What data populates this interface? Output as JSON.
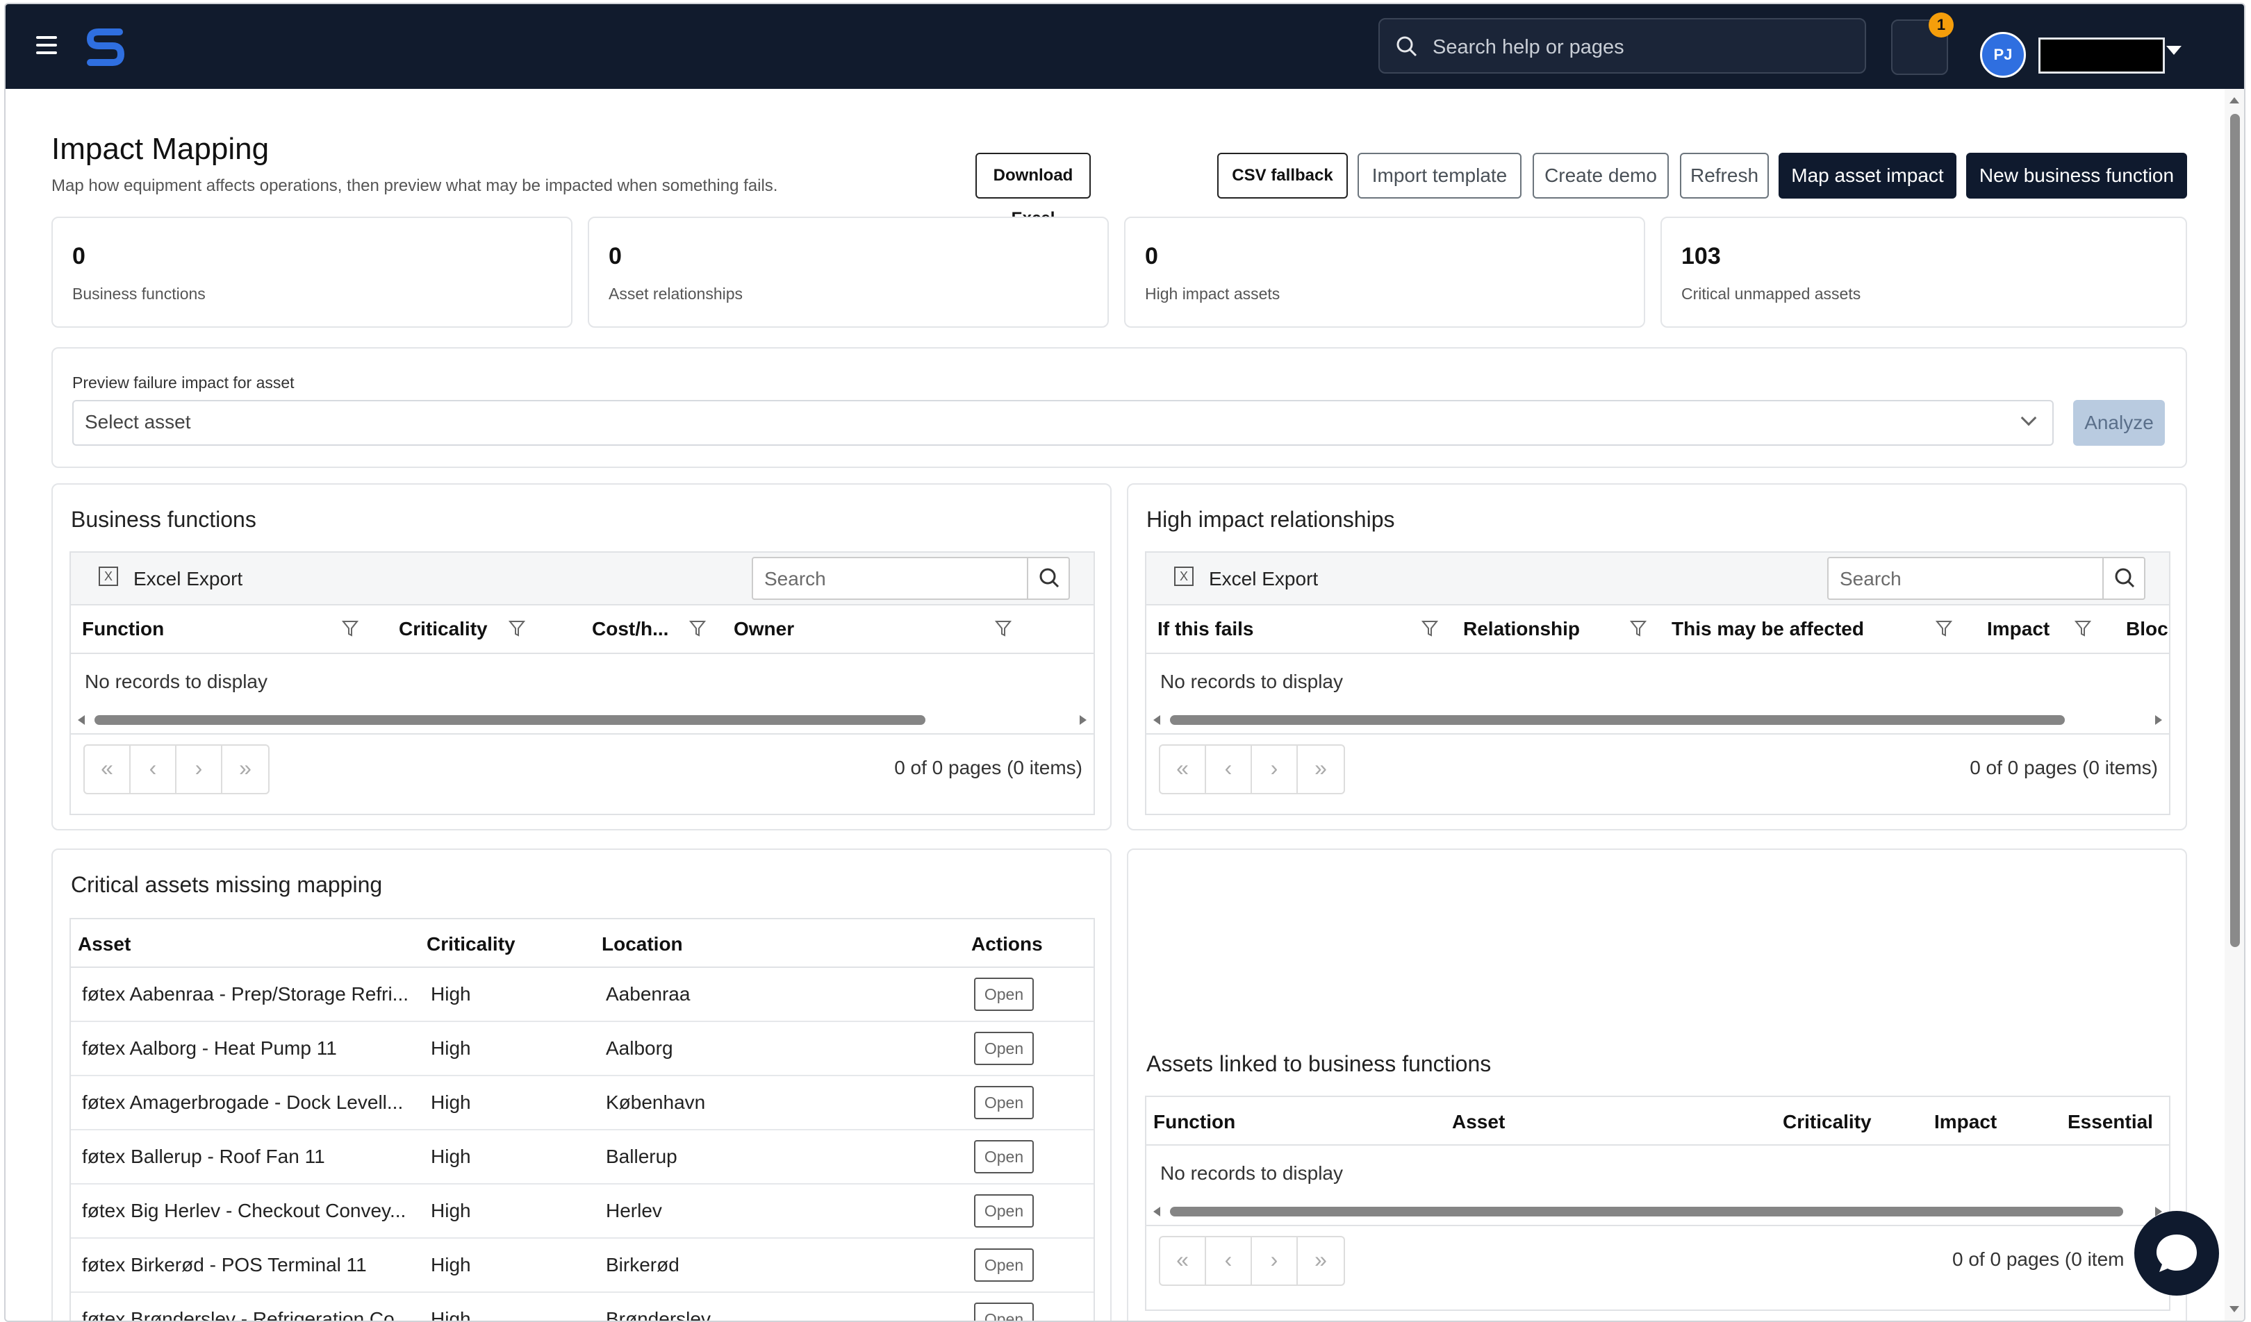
{
  "header": {
    "search_placeholder": "Search help or pages",
    "notifications_count": "1",
    "avatar_initials": "PJ"
  },
  "page": {
    "title": "Impact Mapping",
    "subtitle": "Map how equipment affects operations, then preview what may be impacted when something fails."
  },
  "actions": {
    "download_excel": "Download Excel template",
    "csv_fallback": "CSV fallback",
    "import_template": "Import template",
    "create_demo": "Create demo",
    "refresh": "Refresh",
    "map_asset_impact": "Map asset impact",
    "new_business_function": "New business function"
  },
  "stats": [
    {
      "value": "0",
      "label": "Business functions"
    },
    {
      "value": "0",
      "label": "Asset relationships"
    },
    {
      "value": "0",
      "label": "High impact assets"
    },
    {
      "value": "103",
      "label": "Critical unmapped assets"
    }
  ],
  "preview": {
    "label": "Preview failure impact for asset",
    "placeholder": "Select asset",
    "analyze": "Analyze"
  },
  "business_functions": {
    "title": "Business functions",
    "export": "Excel Export",
    "search": "Search",
    "columns": [
      "Function",
      "Criticality",
      "Cost/h...",
      "Owner"
    ],
    "empty": "No records to display",
    "pager": "0 of 0 pages (0 items)"
  },
  "high_impact": {
    "title": "High impact relationships",
    "export": "Excel Export",
    "search": "Search",
    "columns": [
      "If this fails",
      "Relationship",
      "This may be affected",
      "Impact",
      "Bloc"
    ],
    "empty": "No records to display",
    "pager": "0 of 0 pages (0 items)"
  },
  "critical_missing": {
    "title": "Critical assets missing mapping",
    "columns": [
      "Asset",
      "Criticality",
      "Location",
      "Actions"
    ],
    "open_label": "Open",
    "rows": [
      {
        "asset": "føtex Aabenraa - Prep/Storage Refri...",
        "criticality": "High",
        "location": "Aabenraa"
      },
      {
        "asset": "føtex Aalborg - Heat Pump 11",
        "criticality": "High",
        "location": "Aalborg"
      },
      {
        "asset": "føtex Amagerbrogade - Dock Levell...",
        "criticality": "High",
        "location": "København"
      },
      {
        "asset": "føtex Ballerup - Roof Fan 11",
        "criticality": "High",
        "location": "Ballerup"
      },
      {
        "asset": "føtex Big Herlev - Checkout Convey...",
        "criticality": "High",
        "location": "Herlev"
      },
      {
        "asset": "føtex Birkerød - POS Terminal 11",
        "criticality": "High",
        "location": "Birkerød"
      },
      {
        "asset": "føtex Brønderslev - Refrigeration Co...",
        "criticality": "High",
        "location": "Brønderslev"
      }
    ]
  },
  "linked": {
    "title": "Assets linked to business functions",
    "columns": [
      "Function",
      "Asset",
      "Criticality",
      "Impact",
      "Essential"
    ],
    "empty": "No records to display",
    "pager": "0 of 0 pages (0 item"
  },
  "colors": {
    "navbar": "#111b2d",
    "primary_dark": "#0f1a2e",
    "badge": "#f59e0b",
    "avatar": "#2f6fe0"
  }
}
